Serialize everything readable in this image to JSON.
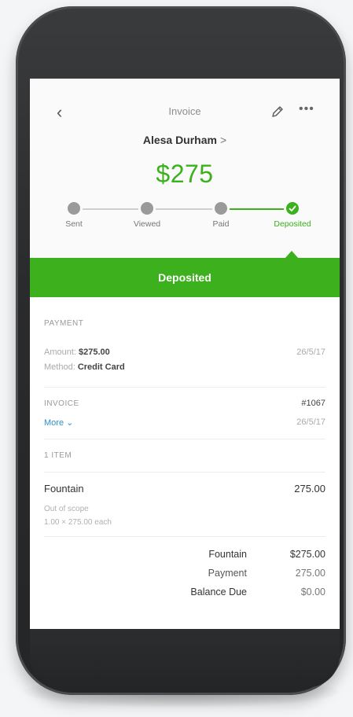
{
  "header": {
    "title": "Invoice",
    "back_icon": "back-chevron-icon",
    "edit_icon": "pencil-icon",
    "more_icon": "more-dots-icon"
  },
  "customer": {
    "name": "Alesa Durham",
    "chevron": ">"
  },
  "amount": "$275",
  "progress": {
    "steps": [
      {
        "label": "Sent",
        "state": "done"
      },
      {
        "label": "Viewed",
        "state": "done"
      },
      {
        "label": "Paid",
        "state": "done"
      },
      {
        "label": "Deposited",
        "state": "current"
      }
    ],
    "accent": "#3cb01d",
    "inactive": "#9a9a9a"
  },
  "banner": {
    "label": "Deposited",
    "color": "#3cb01d"
  },
  "payment": {
    "section": "PAYMENT",
    "amount_label": "Amount:",
    "amount_value": "$275.00",
    "method_label": "Method:",
    "method_value": "Credit Card",
    "date": "26/5/17"
  },
  "invoice": {
    "section": "INVOICE",
    "number": "#1067",
    "more_link": "More ⌄",
    "date": "26/5/17"
  },
  "items": {
    "section": "1 ITEM",
    "list": [
      {
        "name": "Fountain",
        "amount": "275.00",
        "desc": "Out of scope",
        "qty": "1.00 × 275.00 each"
      }
    ]
  },
  "totals": [
    {
      "label": "Fountain",
      "value": "$275.00"
    },
    {
      "label": "Payment",
      "value": "275.00"
    },
    {
      "label": "Balance Due",
      "value": "$0.00"
    }
  ]
}
